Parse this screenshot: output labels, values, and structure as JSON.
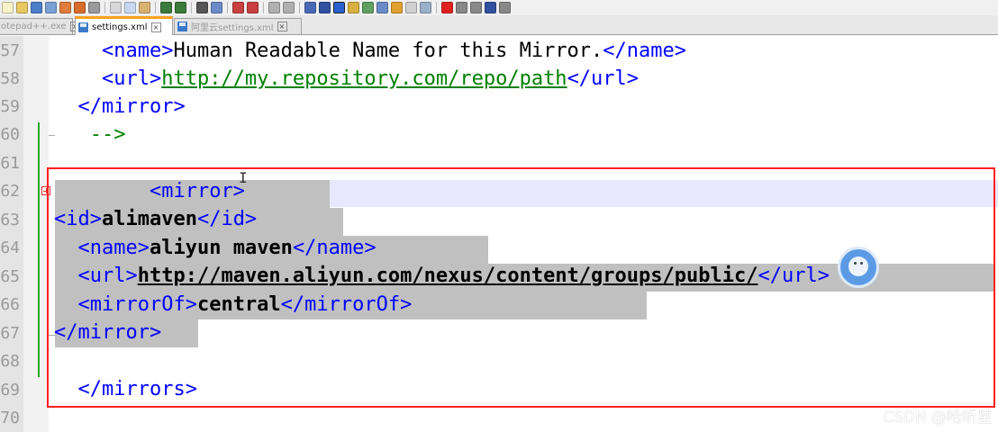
{
  "tabs": [
    {
      "label": "otepad++.exe",
      "active": false
    },
    {
      "label": "settings.xml",
      "active": true
    },
    {
      "label": "阿里云settings.xml",
      "active": false
    }
  ],
  "line_numbers": [
    "57",
    "58",
    "59",
    "60",
    "61",
    "62",
    "63",
    "64",
    "65",
    "66",
    "67",
    "68",
    "69",
    "70"
  ],
  "code": {
    "l57": {
      "open": "<name>",
      "text": "Human Readable Name for this Mirror.",
      "close": "</name>"
    },
    "l58": {
      "open": "<url>",
      "text": "http://my.repository.com/repo/path",
      "close": "</url>"
    },
    "l59": {
      "tag": "</mirror>"
    },
    "l60": {
      "comment": "-->"
    },
    "l62": {
      "tag": "<mirror>"
    },
    "l63": {
      "open": "<id>",
      "text": "alimaven",
      "close": "</id>"
    },
    "l64": {
      "open": "<name>",
      "text": "aliyun maven",
      "close": "</name>"
    },
    "l65": {
      "open": "<url>",
      "text": "http://maven.aliyun.com/nexus/content/groups/public/",
      "close": "</url>"
    },
    "l66": {
      "open": "<mirrorOf>",
      "text": "central",
      "close": "</mirrorOf>"
    },
    "l67": {
      "tag": "</mirror>"
    },
    "l69": {
      "tag": "</mirrors>"
    }
  },
  "watermark": "CSDN @哈听星",
  "colors": {
    "tag": "#0000ff",
    "comment": "#008000",
    "selection": "#c0c0c0",
    "annotation_box": "#ff2020",
    "active_tab_accent": "#f9a11b"
  },
  "icons": [
    "new-file-icon",
    "open-file-icon",
    "save-icon",
    "save-all-icon",
    "close-icon",
    "print-icon",
    "cut-icon",
    "copy-icon",
    "paste-icon",
    "undo-icon",
    "redo-icon",
    "find-icon",
    "replace-icon",
    "zoom-in-icon",
    "zoom-out-icon",
    "wrap-icon",
    "show-all-chars-icon",
    "indent-guide-icon",
    "record-macro-icon",
    "stop-macro-icon",
    "play-macro-icon"
  ]
}
